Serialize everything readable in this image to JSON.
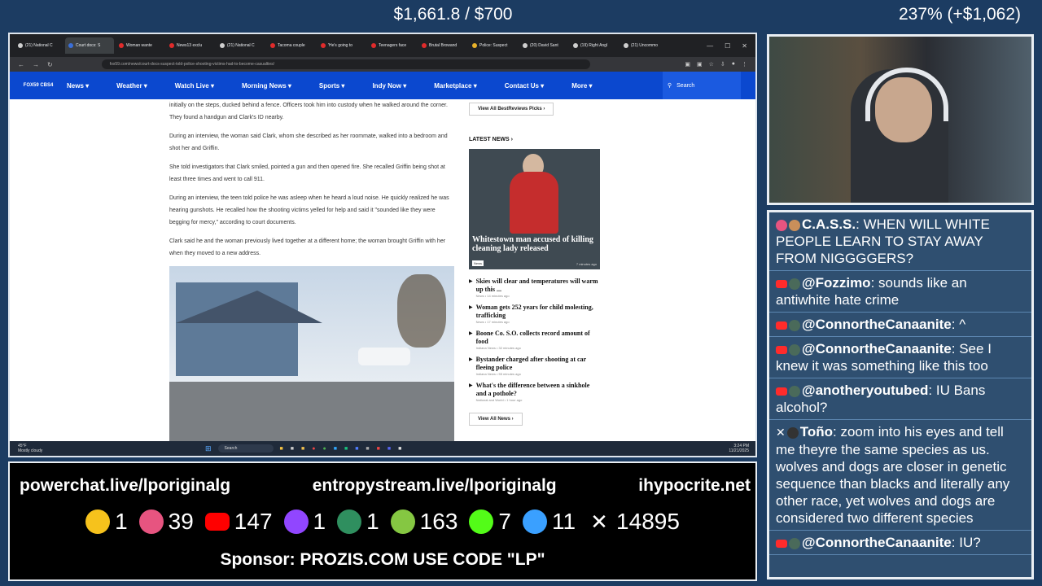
{
  "overlay": {
    "donation": "$1,661.8 / $700",
    "growth": "237% (+$1,062)"
  },
  "browser": {
    "tabs": [
      {
        "label": "(21) National C",
        "color": "#cfcfcf"
      },
      {
        "label": "Court docs: S",
        "color": "#3b6fd8",
        "active": true
      },
      {
        "label": "Woman wante",
        "color": "#e02b2b"
      },
      {
        "label": "News13 exclu",
        "color": "#e02b2b"
      },
      {
        "label": "(21) National C",
        "color": "#cfcfcf"
      },
      {
        "label": "Tacoma couple",
        "color": "#e02b2b"
      },
      {
        "label": "'He's going to",
        "color": "#e02b2b"
      },
      {
        "label": "Teenagers face",
        "color": "#e02b2b"
      },
      {
        "label": "Brutal Browand",
        "color": "#e02b2b"
      },
      {
        "label": "Police: Suspect",
        "color": "#e8b12a"
      },
      {
        "label": "(20) David Sant",
        "color": "#cfcfcf"
      },
      {
        "label": "(19) Right Angl",
        "color": "#cfcfcf"
      },
      {
        "label": "(21) Uncommo",
        "color": "#cfcfcf"
      }
    ],
    "url": "fox59.com/news/court-docs-suspect-told-police-shooting-victims-had-to-become-casualties/"
  },
  "site": {
    "logo": "FOX59 CBS4",
    "nav": [
      "News ▾",
      "Weather ▾",
      "Watch Live ▾",
      "Morning News ▾",
      "Sports ▾",
      "Indy Now ▾",
      "Marketplace ▾",
      "Contact Us ▾",
      "More ▾"
    ],
    "search_label": "Search"
  },
  "article": {
    "paragraphs": [
      "initially on the steps, ducked behind a fence. Officers took him into custody when he walked around the corner. They found a handgun and Clark's ID nearby.",
      "During an interview, the woman said Clark, whom she described as her roommate, walked into a bedroom and shot her and Griffin.",
      "She told investigators that Clark smiled, pointed a gun and then opened fire. She recalled Griffin being shot at least three times and went to call 911.",
      "During an interview, the teen told police he was asleep when he heard a loud noise. He quickly realized he was hearing gunshots. He recalled how the shooting victims yelled for help and said it \"sounded like they were begging for mercy,\" according to court documents.",
      "Clark said he and the woman previously lived together at a different home; the woman brought Griffin with her when they moved to a new address."
    ]
  },
  "sidebar": {
    "view_all_picks": "View All BestReviews Picks ›",
    "latest_title": "LATEST NEWS ›",
    "feature": {
      "caption": "Whitestown man accused of killing cleaning lady released",
      "badge": "News",
      "time": "7 minutes ago"
    },
    "items": [
      {
        "title": "Skies will clear and temperatures will warm up this ...",
        "meta": "News • 14 minutes ago"
      },
      {
        "title": "Woman gets 252 years for child molesting, trafficking",
        "meta": "News • 17 minutes ago"
      },
      {
        "title": "Boone Co. S.O. collects record amount of food",
        "meta": "Indiana News • 32 minutes ago"
      },
      {
        "title": "Bystander charged after shooting at car fleeing police",
        "meta": "Indiana News • 55 minutes ago"
      },
      {
        "title": "What's the difference between a sinkhole and a pothole?",
        "meta": "National and World • 1 hour ago"
      }
    ],
    "view_all_news": "View All News ›"
  },
  "taskbar": {
    "temp": "45°F",
    "weather": "Mostly cloudy",
    "search": "Search",
    "time": "3:24 PM",
    "date": "11/21/2025"
  },
  "chat": [
    {
      "author": "C.A.S.S.",
      "text": "WHEN WILL WHITE PEOPLE LEARN TO STAY AWAY FROM NIGGGGERS?",
      "platform": "kick-style",
      "color": "#e75480"
    },
    {
      "author": "@Fozzimo",
      "text": "sounds like an antiwhite hate crime",
      "platform": "youtube"
    },
    {
      "author": "@ConnortheCanaanite",
      "text": "^",
      "platform": "youtube"
    },
    {
      "author": "@ConnortheCanaanite",
      "text": "See I knew it was something like this too",
      "platform": "youtube"
    },
    {
      "author": "@anotheryoutubed",
      "text": "IU Bans alcohol?",
      "platform": "youtube"
    },
    {
      "author": "Toño",
      "text": "zoom into his eyes and tell me theyre the same species as us. wolves and dogs are closer in genetic sequence than blacks and literally any other race, yet wolves and dogs are considered two different species",
      "platform": "x"
    },
    {
      "author": "@ConnortheCanaanite",
      "text": "IU?",
      "platform": "youtube"
    }
  ],
  "panel": {
    "links": [
      "powerchat.live/lporiginalg",
      "entropystream.live/lporiginalg",
      "ihypocrite.net"
    ],
    "counts": [
      {
        "icon": "rumble-face-icon",
        "value": "1",
        "color": "#f6c21c"
      },
      {
        "icon": "pinwheel-icon",
        "value": "39",
        "color": "#e75480"
      },
      {
        "icon": "youtube-icon",
        "value": "147",
        "color": "#ff0000"
      },
      {
        "icon": "twitch-icon",
        "value": "1",
        "color": "#9146ff"
      },
      {
        "icon": "orb-icon",
        "value": "1",
        "color": "#2f8f5f"
      },
      {
        "icon": "rumble-play-icon",
        "value": "163",
        "color": "#85c742"
      },
      {
        "icon": "kick-icon",
        "value": "7",
        "color": "#53fc18"
      },
      {
        "icon": "moon-icon",
        "value": "11",
        "color": "#3aa0ff"
      },
      {
        "icon": "x-icon",
        "value": "14895",
        "color": "#ffffff"
      }
    ],
    "sponsor": "Sponsor: PROZIS.COM USE CODE \"LP\""
  }
}
